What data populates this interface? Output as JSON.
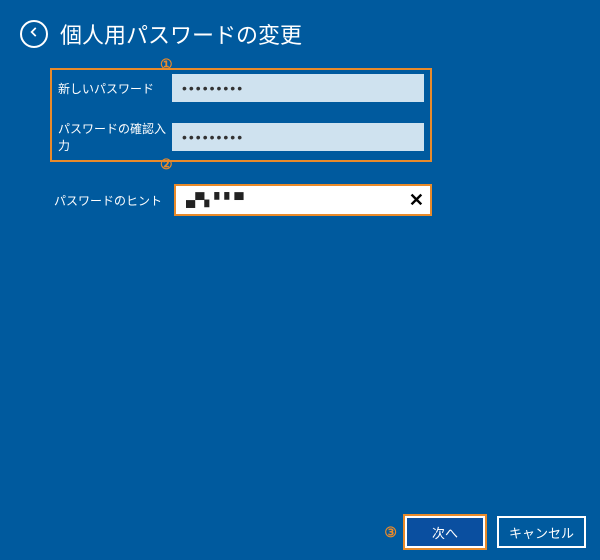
{
  "header": {
    "title": "個人用パスワードの変更"
  },
  "form": {
    "new_password_label": "新しいパスワード",
    "new_password_value": "•••••••••",
    "confirm_password_label": "パスワードの確認入力",
    "confirm_password_value": "•••••••••",
    "hint_label": "パスワードのヒント",
    "hint_value": "▄▀▖▘▘▀",
    "clear_symbol": "✕"
  },
  "annotations": {
    "one": "①",
    "two": "②",
    "three": "③"
  },
  "footer": {
    "next_label": "次へ",
    "cancel_label": "キャンセル"
  }
}
